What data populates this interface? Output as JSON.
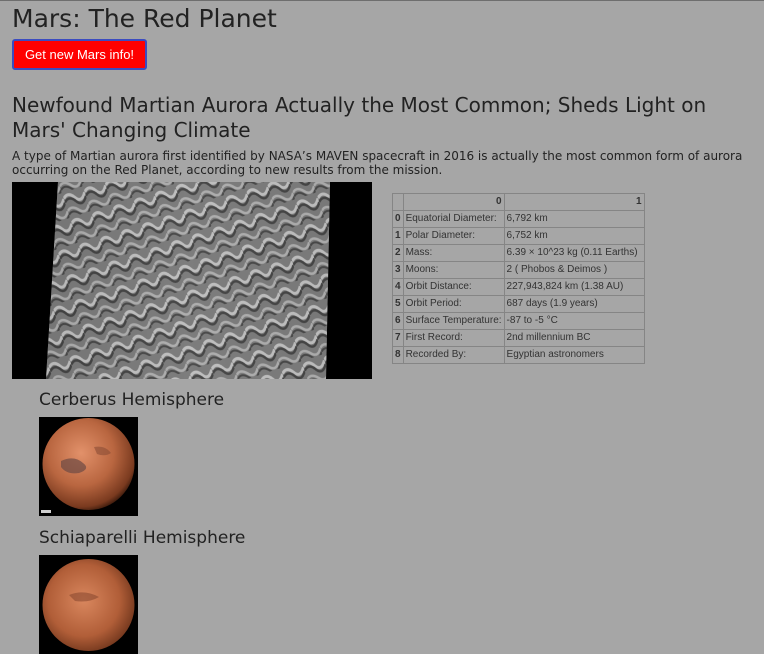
{
  "page": {
    "title": "Mars: The Red Planet",
    "button_label": "Get new Mars info!"
  },
  "news": {
    "title": "Newfound Martian Aurora Actually the Most Common; Sheds Light on Mars' Changing Climate",
    "paragraph": "A type of Martian aurora first identified by NASA’s MAVEN spacecraft in 2016 is actually the most common form of aurora occurring on the Red Planet, according to new results from the mission."
  },
  "facts": {
    "headers": [
      "",
      "0",
      "1"
    ],
    "rows": [
      {
        "idx": "0",
        "label": "Equatorial Diameter:",
        "value": "6,792 km"
      },
      {
        "idx": "1",
        "label": "Polar Diameter:",
        "value": "6,752 km"
      },
      {
        "idx": "2",
        "label": "Mass:",
        "value": "6.39 × 10^23 kg (0.11 Earths)"
      },
      {
        "idx": "3",
        "label": "Moons:",
        "value": "2 ( Phobos & Deimos )"
      },
      {
        "idx": "4",
        "label": "Orbit Distance:",
        "value": "227,943,824 km (1.38 AU)"
      },
      {
        "idx": "5",
        "label": "Orbit Period:",
        "value": "687 days (1.9 years)"
      },
      {
        "idx": "6",
        "label": "Surface Temperature:",
        "value": "-87 to -5 °C"
      },
      {
        "idx": "7",
        "label": "First Record:",
        "value": "2nd millennium BC"
      },
      {
        "idx": "8",
        "label": "Recorded By:",
        "value": "Egyptian astronomers"
      }
    ]
  },
  "hemispheres": [
    {
      "title": "Cerberus Hemisphere"
    },
    {
      "title": "Schiaparelli Hemisphere"
    }
  ],
  "colors": {
    "background": "#a6a6a6",
    "button_bg": "#ff0000",
    "button_border": "#3b4cc0",
    "mars_surface": "#b5603c"
  }
}
